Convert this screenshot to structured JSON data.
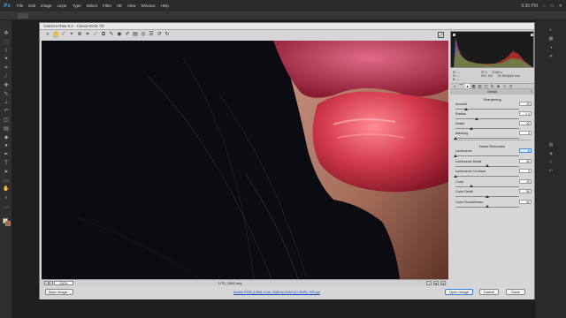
{
  "ps": {
    "logo": "Ps",
    "menus": [
      "File",
      "Edit",
      "Image",
      "Layer",
      "Type",
      "Select",
      "Filter",
      "3D",
      "View",
      "Window",
      "Help"
    ],
    "clock": "5:30 PM"
  },
  "acr": {
    "title": "Camera Raw 9.4  -  Canon EOS 7D",
    "zoom": "200%",
    "filename": "LFD_1866.dng",
    "rgb": {
      "r": "R:",
      "g": "G:",
      "b": "B:",
      "r_val": "---",
      "g_val": "---",
      "b_val": "---"
    },
    "exif": {
      "aperture": "f/7.1",
      "shutter": "1/160 s",
      "iso": "ISO 100",
      "lens": "75-300@83 mm"
    },
    "panel_title": "Detail",
    "sharpening": {
      "title": "Sharpening",
      "sliders": [
        {
          "label": "Amount",
          "value": "25",
          "fraction": 0.17
        },
        {
          "label": "Radius",
          "value": "1.0",
          "fraction": 0.33
        },
        {
          "label": "Detail",
          "value": "25",
          "fraction": 0.25
        },
        {
          "label": "Masking",
          "value": "0",
          "fraction": 0.0
        }
      ]
    },
    "noise": {
      "title": "Noise Reduction",
      "sliders": [
        {
          "label": "Luminance",
          "value": "0",
          "fraction": 0.0,
          "focus": true
        },
        {
          "label": "Luminance Detail",
          "value": "50",
          "fraction": 0.5
        },
        {
          "label": "Luminance Contrast",
          "value": "0",
          "fraction": 0.0
        },
        {
          "label": "Color",
          "value": "25",
          "fraction": 0.25
        },
        {
          "label": "Color Detail",
          "value": "50",
          "fraction": 0.5
        },
        {
          "label": "Color Smoothness",
          "value": "50",
          "fraction": 0.5
        }
      ]
    },
    "buttons": {
      "save": "Save Image...",
      "open": "Open Image",
      "cancel": "Cancel",
      "done": "Done"
    },
    "workflow_link": "Adobe RGB (1998); 8 bit; 3456 by 5184 (17.9MP); 300 ppi"
  }
}
